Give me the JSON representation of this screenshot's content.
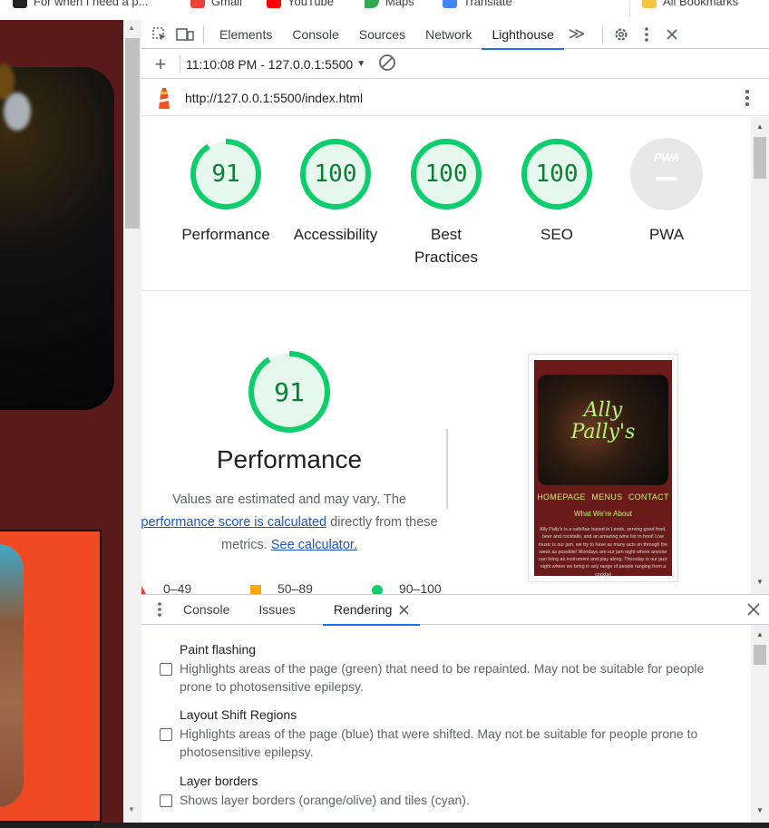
{
  "bookmarks": [
    {
      "label": "For when I need a p...",
      "color": "#222222"
    },
    {
      "label": "Gmail",
      "color": "#ea4335"
    },
    {
      "label": "YouTube",
      "color": "#ff0000"
    },
    {
      "label": "Maps",
      "color": "#34a853"
    },
    {
      "label": "Translate",
      "color": "#4285f4"
    },
    {
      "label": "All Bookmarks",
      "color": "#f4c542"
    }
  ],
  "devtools": {
    "tabs": [
      "Elements",
      "Console",
      "Sources",
      "Network",
      "Lighthouse"
    ],
    "active_tab": "Lighthouse",
    "more_tabs": "≫",
    "toolbar": {
      "add": "+",
      "report_selector": "11:10:08 PM - 127.0.0.1:5500",
      "dropdown_arrow": "▼"
    },
    "url": "http://127.0.0.1:5500/index.html"
  },
  "scores": [
    {
      "name": "Performance",
      "value": "91",
      "fraction": 0.91
    },
    {
      "name": "Accessibility",
      "value": "100",
      "fraction": 1.0
    },
    {
      "name": "Best Practices",
      "value": "100",
      "fraction": 1.0
    },
    {
      "name": "SEO",
      "value": "100",
      "fraction": 1.0
    },
    {
      "name": "PWA",
      "value": "",
      "fraction": 0
    }
  ],
  "pwa_badge": "PWA",
  "performance": {
    "score": "91",
    "fraction": 0.91,
    "title": "Performance",
    "desc_1": "Values are estimated and may vary. The",
    "desc_link": "performance score is calculated",
    "desc_2": " directly from these",
    "desc_3": "metrics. ",
    "desc_calc": "See calculator.",
    "legend": [
      "0–49",
      "50–89",
      "90–100"
    ]
  },
  "thumbnail": {
    "title_1": "Ally",
    "title_2": "Pally's",
    "nav": [
      "HOMEPAGE",
      "MENUS",
      "CONTACT"
    ],
    "subtitle": "What We're About",
    "paragraph": "Ally Pally's is a cafe/bar based in Leeds, serving good food, beer and cocktails, and an amazing wine list to boot! Live music is our jam, we try to have as many acts on through the week as possible! Mondays are our jam night where anyone can bring an instrument and play along. Thursday is our jazz night where we bring in any range of people ranging from a cocktail"
  },
  "drawer": {
    "tabs": [
      "Console",
      "Issues",
      "Rendering"
    ],
    "active_tab": "Rendering",
    "options": [
      {
        "title": "Paint flashing",
        "desc": "Highlights areas of the page (green) that need to be repainted. May not be suitable for people prone to photosensitive epilepsy.",
        "checked": false
      },
      {
        "title": "Layout Shift Regions",
        "desc": "Highlights areas of the page (blue) that were shifted. May not be suitable for people prone to photosensitive epilepsy.",
        "checked": false
      },
      {
        "title": "Layer borders",
        "desc": "Shows layer borders (orange/olive) and tiles (cyan).",
        "checked": false
      }
    ]
  },
  "colors": {
    "pass": "#0cce6b",
    "pass_text": "#0a7d33",
    "accent": "#1a73e8",
    "page_bg": "#5a1a1a"
  }
}
